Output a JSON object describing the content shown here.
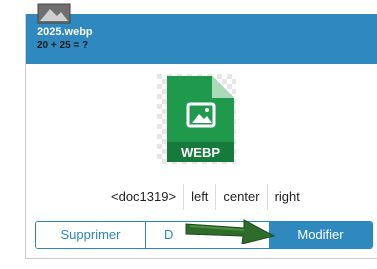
{
  "card": {
    "title": "2025.webp",
    "subtitle": "20 + 25 = ?",
    "file_type_label": "WEBP",
    "doc_ref": "<doc1319>",
    "align_options": [
      "left",
      "center",
      "right"
    ],
    "buttons": {
      "delete": "Supprimer",
      "middle": "D",
      "modify": "Modifier"
    }
  },
  "colors": {
    "header": "#2f89bf",
    "file_icon": "#1f9a4c",
    "arrow": "#2f6b2a"
  }
}
